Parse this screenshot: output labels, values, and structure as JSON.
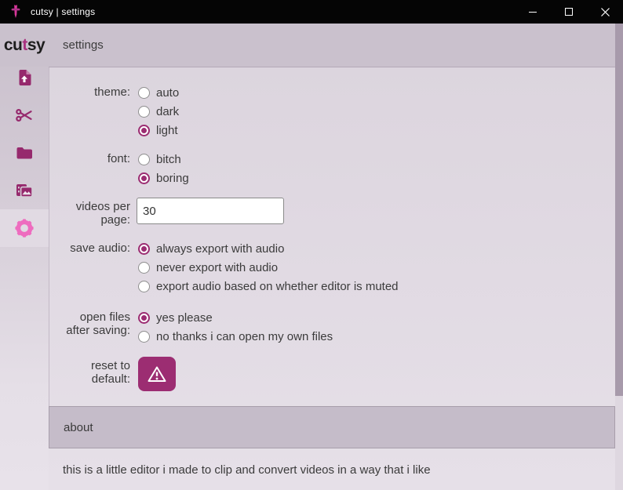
{
  "titlebar": {
    "title": "cutsy | settings",
    "icons": {
      "app": "cutsy-dagger-icon",
      "minimize": "minimize-icon",
      "maximize": "maximize-icon",
      "close": "close-icon"
    }
  },
  "logo": {
    "prefix": "cu",
    "accent": "t",
    "suffix": "sy"
  },
  "header": {
    "title": "settings"
  },
  "sidebar": {
    "items": [
      {
        "name": "import",
        "icon": "upload-file-icon",
        "active": false
      },
      {
        "name": "cut",
        "icon": "scissors-icon",
        "active": false
      },
      {
        "name": "files",
        "icon": "folder-icon",
        "active": false
      },
      {
        "name": "gallery",
        "icon": "video-gallery-icon",
        "active": false
      },
      {
        "name": "settings",
        "icon": "gear-icon",
        "active": true
      }
    ]
  },
  "form": {
    "groups": [
      {
        "id": "theme",
        "label": "theme:",
        "options": [
          {
            "label": "auto",
            "checked": false
          },
          {
            "label": "dark",
            "checked": false
          },
          {
            "label": "light",
            "checked": true
          }
        ]
      },
      {
        "id": "font",
        "label": "font:",
        "options": [
          {
            "label": "bitch",
            "checked": false
          },
          {
            "label": "boring",
            "checked": true
          }
        ]
      },
      {
        "id": "videos_per_page",
        "label": "videos per page:",
        "value": "30"
      },
      {
        "id": "save_audio",
        "label": "save audio:",
        "options": [
          {
            "label": "always export with audio",
            "checked": true
          },
          {
            "label": "never export with audio",
            "checked": false
          },
          {
            "label": "export audio based on whether editor is muted",
            "checked": false
          }
        ]
      },
      {
        "id": "open_files",
        "label": "open files after saving:",
        "options": [
          {
            "label": "yes please",
            "checked": true
          },
          {
            "label": "no thanks i can open my own files",
            "checked": false
          }
        ]
      },
      {
        "id": "reset",
        "label": "reset to default:",
        "icon": "warning-icon"
      }
    ]
  },
  "about": {
    "title": "about",
    "text": "this is a little editor i made to clip and convert videos in a way that i like"
  },
  "colors": {
    "accent": "#9c2d72",
    "active_icon_pink": "#ee6cbf",
    "titlebar": "#050505",
    "header_band": "#cac1cd",
    "about_band": "#c5bcc9"
  }
}
